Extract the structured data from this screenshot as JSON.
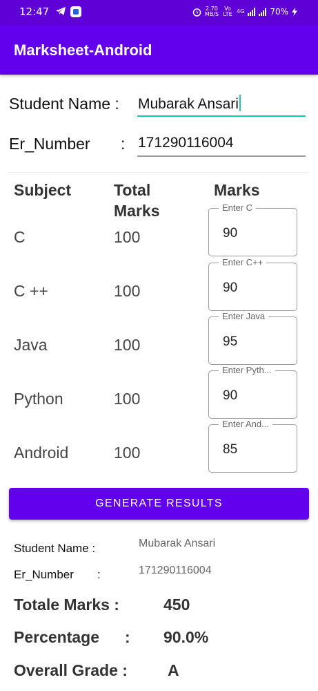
{
  "status_bar": {
    "time": "12:47",
    "net_speed_value": "2.70",
    "net_speed_unit": "MB/S",
    "volte": "Vo LTE",
    "signal_type": "4G",
    "battery": "70%"
  },
  "app_bar": {
    "title": "Marksheet-Android"
  },
  "form": {
    "name_label": "Student Name :",
    "name_value": "Mubarak Ansari",
    "er_label": "Er_Number",
    "er_colon": ":",
    "er_value": "171290116004"
  },
  "table": {
    "headers": {
      "subject": "Subject",
      "total": "Total Marks",
      "marks": "Marks"
    },
    "rows": [
      {
        "subject": "C",
        "total": "100",
        "hint": "Enter C",
        "value": "90"
      },
      {
        "subject": "C ++",
        "total": "100",
        "hint": "Enter C++",
        "value": "90"
      },
      {
        "subject": "Java",
        "total": "100",
        "hint": "Enter Java",
        "value": "95"
      },
      {
        "subject": "Python",
        "total": "100",
        "hint": "Enter Pyth...",
        "value": "90"
      },
      {
        "subject": "Android",
        "total": "100",
        "hint": "Enter And...",
        "value": "85"
      }
    ]
  },
  "button": {
    "label": "GENERATE RESULTS",
    "color": "#6200ee"
  },
  "result": {
    "name_label": "Student Name :",
    "name_value": "Mubarak Ansari",
    "er_label": "Er_Number",
    "er_colon": ":",
    "er_value": "171290116004",
    "total_label": "Totale Marks :",
    "total_value": "450",
    "percentage_label": "Percentage",
    "percentage_colon": ":",
    "percentage_value": "90.0%",
    "grade_label": "Overall Grade :",
    "grade_value": "A"
  },
  "colors": {
    "primary": "#6200ee",
    "status_bar": "#5e00d6",
    "accent": "#1ec8b8"
  }
}
